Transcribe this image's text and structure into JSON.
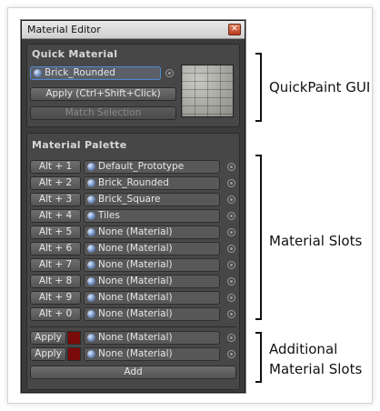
{
  "window": {
    "title": "Material Editor",
    "close_glyph": "✕"
  },
  "quick_material": {
    "heading": "Quick Material",
    "material_field": "Brick_Rounded",
    "apply_button": "Apply (Ctrl+Shift+Click)",
    "match_button": "Match Selection",
    "preview_icon": "brick-texture-preview"
  },
  "palette": {
    "heading": "Material Palette",
    "slots": [
      {
        "key": "Alt + 1",
        "material": "Default_Prototype"
      },
      {
        "key": "Alt + 2",
        "material": "Brick_Rounded"
      },
      {
        "key": "Alt + 3",
        "material": "Brick_Square"
      },
      {
        "key": "Alt + 4",
        "material": "Tiles"
      },
      {
        "key": "Alt + 5",
        "material": "None (Material)"
      },
      {
        "key": "Alt + 6",
        "material": "None (Material)"
      },
      {
        "key": "Alt + 7",
        "material": "None (Material)"
      },
      {
        "key": "Alt + 8",
        "material": "None (Material)"
      },
      {
        "key": "Alt + 9",
        "material": "None (Material)"
      },
      {
        "key": "Alt + 0",
        "material": "None (Material)"
      }
    ]
  },
  "additional": {
    "slots": [
      {
        "button": "Apply",
        "material": "None (Material)",
        "color": "#7b0a0a"
      },
      {
        "button": "Apply",
        "material": "None (Material)",
        "color": "#7b0a0a"
      }
    ],
    "add_button": "Add"
  },
  "annotations": {
    "quickpaint": "QuickPaint GUI",
    "material_slots": "Material Slots",
    "additional_line1": "Additional",
    "additional_line2": "Material Slots"
  },
  "colors": {
    "panel_bg": "#3b3b3b",
    "selection_border": "#4f8ad6",
    "swatch_red": "#7b0a0a"
  }
}
